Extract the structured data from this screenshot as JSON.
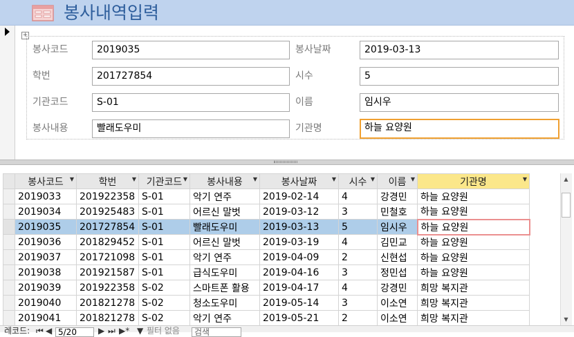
{
  "form": {
    "title": "봉사내역입력",
    "fields": {
      "volunteer_code": {
        "label": "봉사코드",
        "value": "2019035"
      },
      "student_no": {
        "label": "학번",
        "value": "201727854"
      },
      "org_code": {
        "label": "기관코드",
        "value": "S-01"
      },
      "content": {
        "label": "봉사내용",
        "value": "빨래도우미"
      },
      "date": {
        "label": "봉사날짜",
        "value": "2019-03-13"
      },
      "hours": {
        "label": "시수",
        "value": "5"
      },
      "name": {
        "label": "이름",
        "value": "임시우"
      },
      "org_name": {
        "label": "기관명",
        "value": "하늘 요양원"
      }
    }
  },
  "datasheet": {
    "columns": [
      "봉사코드",
      "학번",
      "기관코드",
      "봉사내용",
      "봉사날짜",
      "시수",
      "이름",
      "기관명"
    ],
    "rows": [
      [
        "2019033",
        "201922358",
        "S-01",
        "악기 연주",
        "2019-02-14",
        "4",
        "강경민",
        "하늘 요양원"
      ],
      [
        "2019034",
        "201925483",
        "S-01",
        "어르신 말벗",
        "2019-03-12",
        "3",
        "민철호",
        "하늘 요양원"
      ],
      [
        "2019035",
        "201727854",
        "S-01",
        "빨래도우미",
        "2019-03-13",
        "5",
        "임시우",
        "하늘 요양원"
      ],
      [
        "2019036",
        "201829452",
        "S-01",
        "어르신 말벗",
        "2019-03-19",
        "4",
        "김민교",
        "하늘 요양원"
      ],
      [
        "2019037",
        "201721098",
        "S-01",
        "악기 연주",
        "2019-04-09",
        "2",
        "신현섭",
        "하늘 요양원"
      ],
      [
        "2019038",
        "201921587",
        "S-01",
        "급식도우미",
        "2019-04-16",
        "3",
        "정민섭",
        "하늘 요양원"
      ],
      [
        "2019039",
        "201922358",
        "S-02",
        "스마트폰 활용",
        "2019-04-17",
        "4",
        "강경민",
        "희망 복지관"
      ],
      [
        "2019040",
        "201821278",
        "S-02",
        "청소도우미",
        "2019-05-14",
        "3",
        "이소연",
        "희망 복지관"
      ],
      [
        "2019041",
        "201821278",
        "S-02",
        "악기 연주",
        "2019-05-21",
        "2",
        "이소연",
        "희망 복지관"
      ]
    ],
    "current_row": 2
  },
  "navigation": {
    "label": "레코드:",
    "current": "5/20",
    "filter": "필터 없음",
    "search_placeholder": "검색"
  },
  "colors": {
    "header_bg": "#bfd3ee",
    "title": "#2e5e9c",
    "selected_row": "#aecde9",
    "focus_border": "#f0a030",
    "active_column": "#fbe78a"
  }
}
